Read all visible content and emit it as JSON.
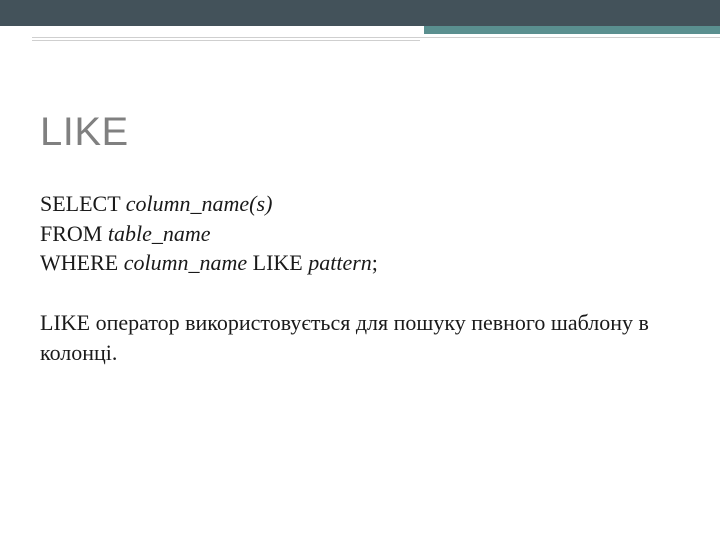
{
  "title": "LIKE",
  "sql": {
    "line1_kw": "SELECT ",
    "line1_it": "column_name(s)",
    "line2_kw": "FROM ",
    "line2_it": "table_name",
    "line3_kw1": "WHERE ",
    "line3_it1": "column_name",
    "line3_kw2": " LIKE ",
    "line3_it2": "pattern",
    "line3_end": ";"
  },
  "description": "LIKE оператор використовується для пошуку певного шаблону в колонці."
}
